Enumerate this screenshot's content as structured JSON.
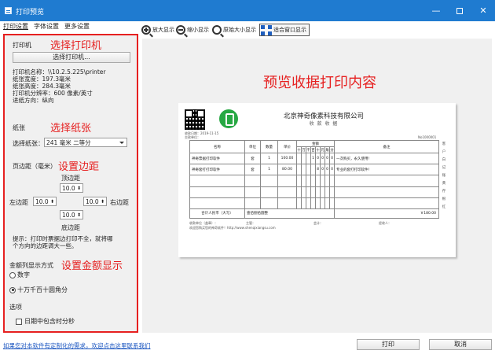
{
  "window": {
    "title": "打印预览",
    "controls": {
      "minimize": "—",
      "close": "✕"
    }
  },
  "tabs": [
    {
      "label": "打印设置",
      "active": true
    },
    {
      "label": "字体设置",
      "active": false
    },
    {
      "label": "更多设置",
      "active": false
    }
  ],
  "toolbar": {
    "zoom_in": "放大显示",
    "zoom_out": "缩小显示",
    "actual_size": "原始大小显示",
    "fit_window": "适合窗口显示"
  },
  "panel": {
    "printer_label": "打印机",
    "printer_annot": "选择打印机",
    "select_printer_button": "选择打印机...",
    "printer_info": [
      "打印机名称：\\\\10.2.5.225\\printer",
      "纸张宽度：197.3毫米",
      "纸张高度：284.3毫米",
      "打印机分辨率：600 像素/英寸",
      "进纸方向：纵向"
    ],
    "paper_label": "纸张",
    "paper_annot": "选择纸张",
    "paper_select_label": "选择纸张：",
    "paper_value": "241 毫米 二等分",
    "margin_label": "页边距（毫米）",
    "margin_annot": "设置边距",
    "top_label": "顶边距",
    "top_value": "10.0",
    "left_label": "左边距",
    "left_value": "10.0",
    "right_label": "右边距",
    "right_value": "10.0",
    "bottom_value": "10.0",
    "bottom_label": "底边距",
    "tip": [
      "提示：打印时票据边打印不全，就将哪",
      "个方向的边距调大一些。"
    ],
    "amount_label": "金额列显示方式",
    "amount_annot": "设置金额显示",
    "amount_options": [
      {
        "label": "数字",
        "checked": false
      },
      {
        "label": "十万千百十圆角分",
        "checked": true
      }
    ],
    "options_label": "选项",
    "date_checkbox": {
      "label": "日期中包含时分秒",
      "checked": false
    }
  },
  "preview": {
    "headline": "预览收据打印内容",
    "receipt": {
      "company": "北京神奇像素科技有限公司",
      "subtitle": "收 款 收 据",
      "date_line": "收款日期：2019-11-15",
      "unit_line": "交款单位：",
      "number": "No1000001",
      "headers": [
        "名称",
        "单位",
        "数量",
        "单价",
        "金额",
        "备注"
      ],
      "amount_sub": [
        "十",
        "万",
        "千",
        "百",
        "十",
        "元",
        "角",
        "分"
      ],
      "rows": [
        {
          "name": "神奇票据打印软件",
          "unit": "套",
          "qty": "1",
          "price": "100.00",
          "digits": [
            "",
            "",
            "",
            "1",
            "0",
            "0",
            "0",
            "0"
          ],
          "note": "一次购买，永久使用！"
        },
        {
          "name": "神奇套打打印软件",
          "unit": "套",
          "qty": "1",
          "price": "80.00",
          "digits": [
            "",
            "",
            "",
            "",
            "8",
            "0",
            "0",
            "0"
          ],
          "note": "专业的套打打印软件！"
        }
      ],
      "total_label": "合计人民币（大写）",
      "total_words": "壹佰捌拾圆整",
      "total_value": "￥180.00",
      "footer_left": "收款单位（盖章）：",
      "footer_mid1": "主管：",
      "footer_mid2": "会计：",
      "footer_right": "经收人：",
      "website": "欢迎您购买您的神奇软件！http://www.shenqixiangsu.com",
      "side_marks": [
        "客",
        "户",
        "",
        "白",
        "",
        "记",
        "账",
        "",
        "黄",
        "",
        "存",
        "根",
        "",
        "红"
      ]
    }
  },
  "bottom": {
    "link": "如果您对本软件有定制化的需求，欢迎点击这里联系我们",
    "print_button": "打印",
    "cancel_button": "取消"
  },
  "colors": {
    "titlebar": "#1f7bd0",
    "annotation_red": "#e62020",
    "link": "#1a55c0"
  }
}
